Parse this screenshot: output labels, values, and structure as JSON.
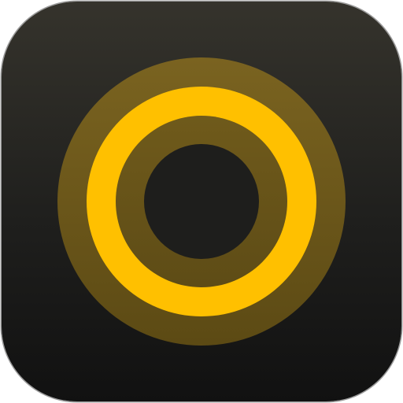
{
  "icon": {
    "name": "concentric-rings-icon",
    "colors": {
      "background_top": "#35332c",
      "background_bottom": "#111111",
      "outer_ring": "#75601d",
      "middle_ring": "#ffc000",
      "inner_ring": "#6b5718",
      "core": "#1e1e1c",
      "border": "#9a9a9a"
    }
  }
}
